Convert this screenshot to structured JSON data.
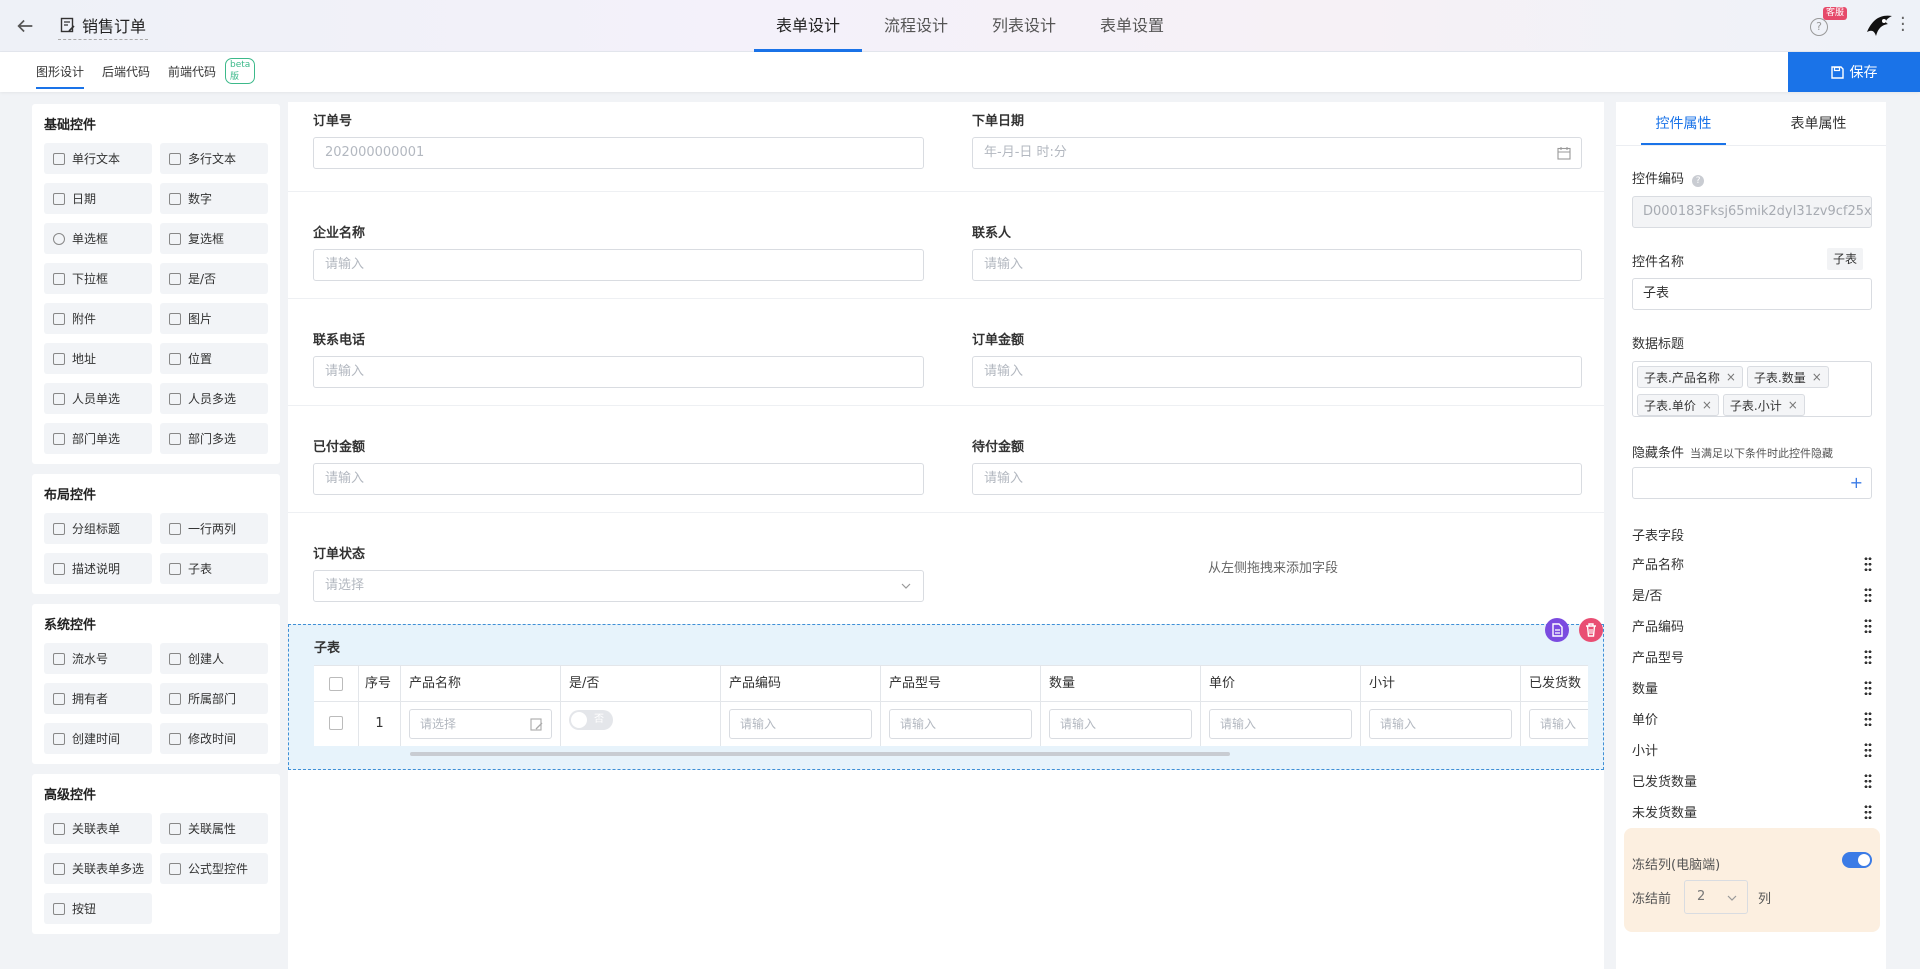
{
  "header": {
    "title": "销售订单",
    "tabs": [
      "表单设计",
      "流程设计",
      "列表设计",
      "表单设置"
    ],
    "badge": "客服",
    "help": "?"
  },
  "subbar": {
    "tabs": [
      "图形设计",
      "后端代码",
      "前端代码"
    ],
    "beta": "beta版",
    "save": "保存"
  },
  "palette": [
    {
      "title": "基础控件",
      "items": [
        "单行文本",
        "多行文本",
        "日期",
        "数字",
        "单选框",
        "复选框",
        "下拉框",
        "是/否",
        "附件",
        "图片",
        "地址",
        "位置",
        "人员单选",
        "人员多选",
        "部门单选",
        "部门多选"
      ]
    },
    {
      "title": "布局控件",
      "items": [
        "分组标题",
        "一行两列",
        "描述说明",
        "子表"
      ]
    },
    {
      "title": "系统控件",
      "items": [
        "流水号",
        "创建人",
        "拥有者",
        "所属部门",
        "创建时间",
        "修改时间"
      ]
    },
    {
      "title": "高级控件",
      "items": [
        "关联表单",
        "关联属性",
        "关联表单多选",
        "公式型控件",
        "按钮"
      ]
    }
  ],
  "form": {
    "order_no": {
      "label": "订单号",
      "value": "202000000001"
    },
    "order_date": {
      "label": "下单日期",
      "placeholder": "年-月-日 时:分"
    },
    "company": {
      "label": "企业名称",
      "placeholder": "请输入"
    },
    "contact": {
      "label": "联系人",
      "placeholder": "请输入"
    },
    "phone": {
      "label": "联系电话",
      "placeholder": "请输入"
    },
    "amount": {
      "label": "订单金额",
      "placeholder": "请输入"
    },
    "paid": {
      "label": "已付金额",
      "placeholder": "请输入"
    },
    "due": {
      "label": "待付金额",
      "placeholder": "请输入"
    },
    "status": {
      "label": "订单状态",
      "placeholder": "请选择"
    },
    "drop_hint": "从左侧拖拽来添加字段"
  },
  "subtable": {
    "title": "子表",
    "columns": [
      "序号",
      "产品名称",
      "是/否",
      "产品编码",
      "产品型号",
      "数量",
      "单价",
      "小计",
      "已发货数"
    ],
    "row": {
      "index": "1",
      "select_placeholder": "请选择",
      "toggle_text": "否",
      "input_placeholder": "请输入"
    }
  },
  "right": {
    "tabs": [
      "控件属性",
      "表单属性"
    ],
    "code_label": "控件编码",
    "code_value": "D000183Fksj65mik2dyI31zv9cf25x",
    "name_label": "控件名称",
    "name_tag": "子表",
    "name_value": "子表",
    "data_title_label": "数据标题",
    "tags": [
      "子表.产品名称",
      "子表.数量",
      "子表.单价",
      "子表.小计"
    ],
    "hide_label": "隐藏条件",
    "hide_hint": "当满足以下条件时此控件隐藏",
    "fields_label": "子表字段",
    "fields": [
      "产品名称",
      "是/否",
      "产品编码",
      "产品型号",
      "数量",
      "单价",
      "小计",
      "已发货数量",
      "未发货数量"
    ],
    "freeze_label": "冻结列(电脑端)",
    "freeze_prefix": "冻结前",
    "freeze_value": "2",
    "freeze_suffix": "列"
  }
}
